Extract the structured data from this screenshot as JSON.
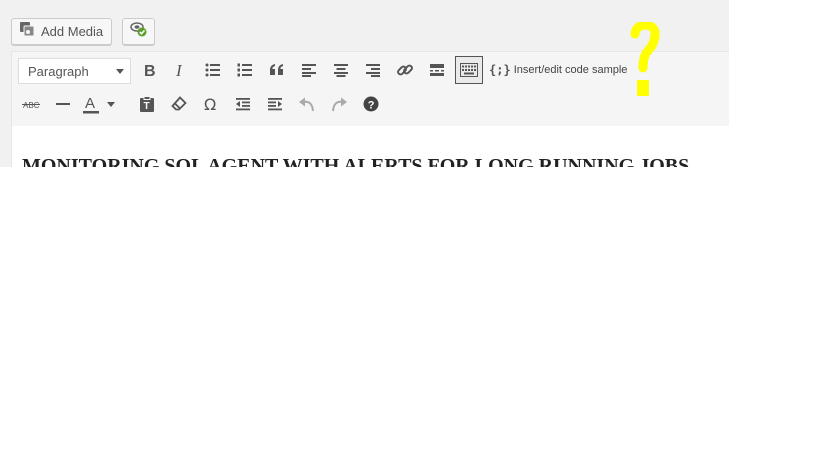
{
  "media_bar": {
    "add_media_label": "Add Media",
    "add_media_icon": "media-icon",
    "plugin_icon": "plugin-check-icon"
  },
  "toolbar": {
    "format_select": {
      "value": "Paragraph"
    },
    "row1": [
      "bold-icon",
      "italic-icon",
      "bullet-list-icon",
      "numbered-list-icon",
      "blockquote-icon",
      "align-left-icon",
      "align-center-icon",
      "align-right-icon",
      "link-icon",
      "read-more-icon",
      "toolbar-toggle-icon"
    ],
    "code_sample": {
      "braces": "{;}",
      "label": "Insert/edit code sample"
    },
    "row2": [
      "strikethrough-icon",
      "horizontal-line-icon",
      "text-color-icon",
      "paste-text-icon",
      "clear-formatting-icon",
      "special-character-icon",
      "outdent-icon",
      "indent-icon",
      "undo-icon",
      "redo-icon",
      "help-icon"
    ],
    "strikethrough_text": "ABC",
    "text_color_letter": "A"
  },
  "content": {
    "heading": "MONITORING SQL AGENT WITH ALERTS FOR LONG RUNNING JOBS"
  },
  "annotation": {
    "marker_icon": "question-mark-icon",
    "color": "#ffff00"
  }
}
